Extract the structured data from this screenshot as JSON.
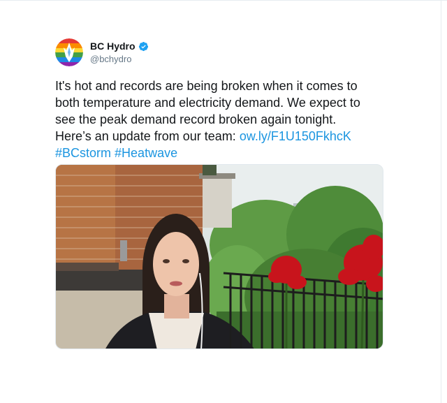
{
  "tweet": {
    "author": {
      "display_name": "BC Hydro",
      "handle": "@bchydro",
      "verified": true,
      "verified_icon": "verified-badge-icon",
      "avatar_icon": "bc-hydro-rainbow-logo"
    },
    "text_lines": [
      "It's hot and records are being broken when it comes to",
      "both temperature and electricity demand. We expect to",
      "see the peak demand record broken again tonight.",
      "Here’s an update from our team: "
    ],
    "link_text": "ow.ly/F1U150FkhcK",
    "hashtags": [
      "#BCstorm",
      "#Heatwave"
    ],
    "media": {
      "type": "video-thumbnail"
    }
  },
  "colors": {
    "text": "#14171a",
    "secondary_text": "#657786",
    "link": "#1b95e0",
    "verified": "#1da1f2"
  }
}
